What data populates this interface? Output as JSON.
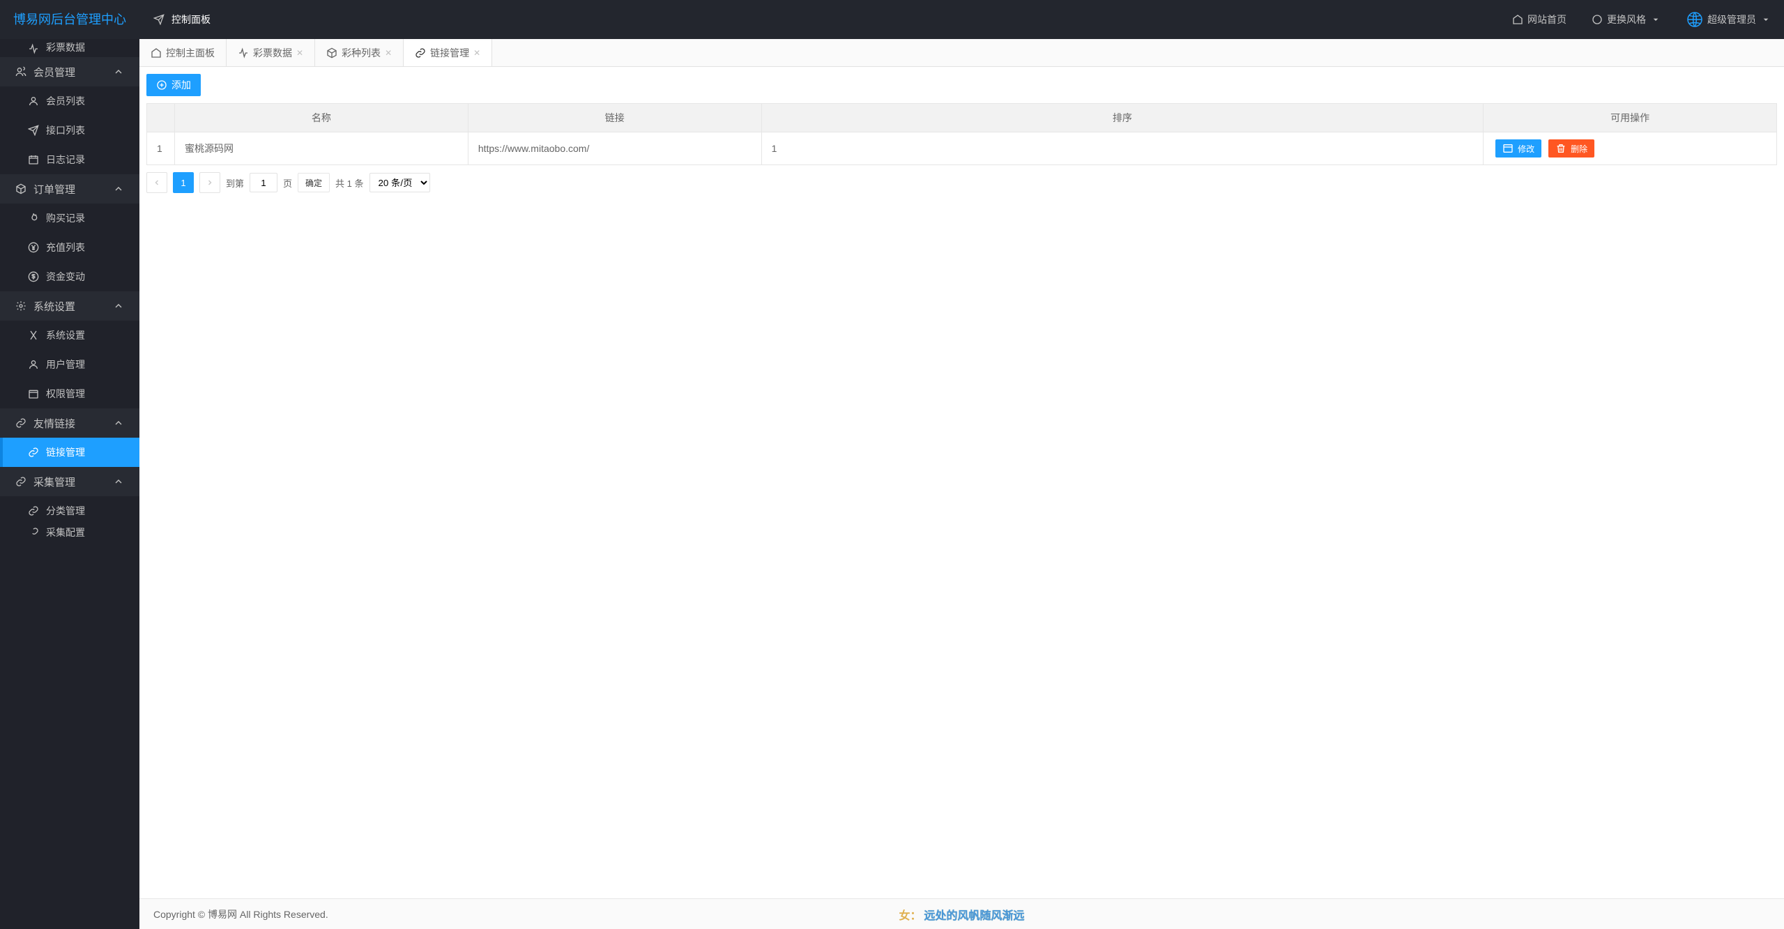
{
  "logo": "博易网后台管理中心",
  "header": {
    "control_panel": "控制面板",
    "website_home": "网站首页",
    "change_style": "更换风格",
    "user": "超级管理员"
  },
  "sidebar": {
    "lottery_data_cut": "彩票数据",
    "groups": [
      {
        "label": "会员管理",
        "items": [
          "会员列表",
          "接口列表",
          "日志记录"
        ]
      },
      {
        "label": "订单管理",
        "items": [
          "购买记录",
          "充值列表",
          "资金变动"
        ]
      },
      {
        "label": "系统设置",
        "items": [
          "系统设置",
          "用户管理",
          "权限管理"
        ]
      },
      {
        "label": "友情链接",
        "items": [
          "链接管理"
        ],
        "active_item": 0
      },
      {
        "label": "采集管理",
        "items": [
          "分类管理",
          "采集配置"
        ]
      }
    ]
  },
  "tabs": [
    {
      "label": "控制主面板",
      "closable": false
    },
    {
      "label": "彩票数据",
      "closable": true
    },
    {
      "label": "彩种列表",
      "closable": true
    },
    {
      "label": "链接管理",
      "closable": true,
      "active": true
    }
  ],
  "toolbar": {
    "add": "添加"
  },
  "table": {
    "headers": [
      "",
      "名称",
      "链接",
      "排序",
      "可用操作"
    ],
    "rows": [
      {
        "idx": "1",
        "name": "蜜桃源码网",
        "link": "https://www.mitaobo.com/",
        "sort": "1"
      }
    ],
    "ops": {
      "edit": "修改",
      "delete": "删除"
    }
  },
  "pager": {
    "current": "1",
    "goto_prefix": "到第",
    "goto_input": "1",
    "goto_suffix": "页",
    "confirm": "确定",
    "total": "共 1 条",
    "page_size": "20 条/页"
  },
  "footer": {
    "copyright": "Copyright © 博易网 All Rights Reserved.",
    "watermark_a": "女：",
    "watermark_b": "远处的风帆随风渐远"
  }
}
